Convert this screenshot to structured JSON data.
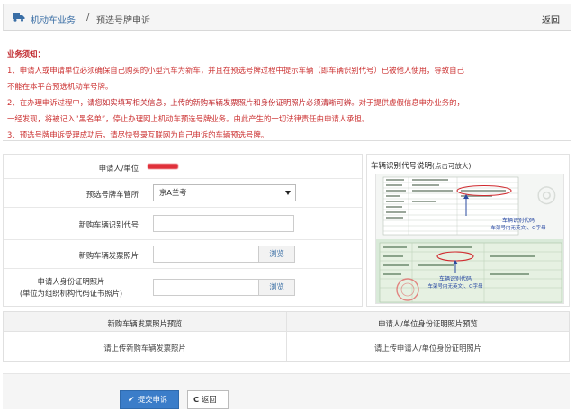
{
  "header": {
    "title": "机动车业务",
    "separator": "/",
    "subtitle": "预选号牌申诉",
    "back_label": "返回"
  },
  "notice": {
    "title": "业务须知：",
    "line1": "1、申请人或申请单位必须确保自己购买的小型汽车为新车，并且在预选号牌过程中提示车辆（即车辆识别代号）已被他人使用，导致自己",
    "line1b": "不能在本平台预选机动车号牌。",
    "line2a": "2、在办理申诉过程中，",
    "line2b": "请您如实填写相关信息，上传的新购车辆发票照片和身份证明照片必须清晰可辨。",
    "line2c": "对于提供虚假信息申办业务的，",
    "line2d": "一经发现，将被记入“黑名单”，停止办理网上机动车预选号牌业务。由此产生的一切法律责任由申请人承担。",
    "line3": "3、预选号牌申诉受理成功后，请尽快登录互联网为自己申诉的车辆预选号牌。"
  },
  "form": {
    "applicant_label": "申请人/单位",
    "office_label": "预选号牌车管所",
    "office_value": "京A兰考",
    "vin_label": "新购车辆识别代号",
    "invoice_label": "新购车辆发票照片",
    "browse_label": "浏览",
    "id_label_line1": "申请人身份证明照片",
    "id_label_line2": "(单位为组织机构代码证书照片)"
  },
  "guide": {
    "title": "车辆识别代号说明",
    "title_hint": "(点击可放大)",
    "annotation1_line1": "车辆识别代码",
    "annotation1_line2": "车架号内无英文I、O字母",
    "annotation2_line1": "车辆识别代码",
    "annotation2_line2": "车架号内无英文I、O字母"
  },
  "preview": {
    "invoice_header": "新购车辆发票照片预览",
    "invoice_placeholder": "请上传新购车辆发票照片",
    "id_header": "申请人/单位身份证明照片预览",
    "id_placeholder": "请上传申请人/单位身份证明照片"
  },
  "footer": {
    "submit_label": "提交申诉",
    "back_label": "返回"
  },
  "colors": {
    "accent": "#3b7dc9",
    "notice_red": "#cc3333",
    "link_blue": "#3a6ea5"
  }
}
